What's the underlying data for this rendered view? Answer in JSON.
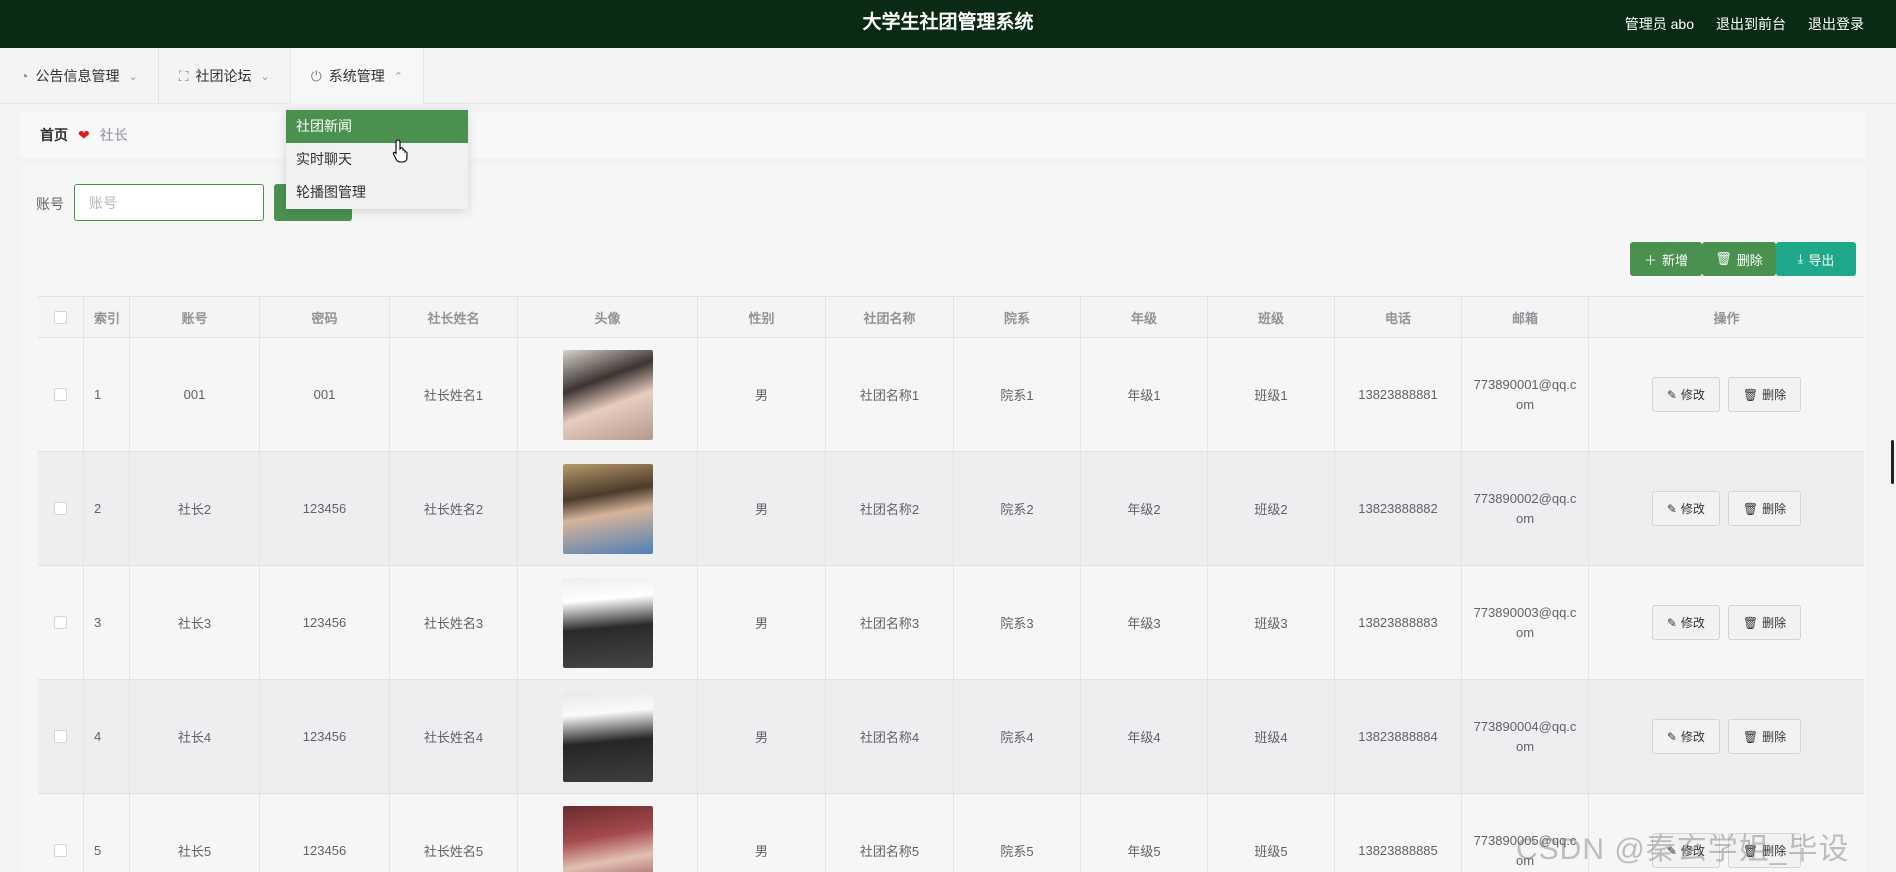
{
  "header": {
    "title": "大学生社团管理系统",
    "user": "管理员 abo",
    "to_front": "退出到前台",
    "logout": "退出登录"
  },
  "menu": [
    {
      "label": "公告信息管理",
      "icon": "dashboard-icon"
    },
    {
      "label": "社团论坛",
      "icon": "fullscreen-icon"
    },
    {
      "label": "系统管理",
      "icon": "power-icon"
    }
  ],
  "dropdown": {
    "items": [
      "社团新闻",
      "实时聊天",
      "轮播图管理"
    ],
    "hovered": "社团新闻"
  },
  "breadcrumb": {
    "home": "首页",
    "current": "社长"
  },
  "search": {
    "label": "账号",
    "placeholder": "账号",
    "value": ""
  },
  "actions": {
    "add": "新增",
    "delete": "删除",
    "export": "导出"
  },
  "table": {
    "columns": [
      "索引",
      "账号",
      "密码",
      "社长姓名",
      "头像",
      "性别",
      "社团名称",
      "院系",
      "年级",
      "班级",
      "电话",
      "邮箱",
      "操作"
    ],
    "rows": [
      {
        "index": "1",
        "account": "001",
        "password": "001",
        "name": "社长姓名1",
        "gender": "男",
        "club": "社团名称1",
        "dept": "院系1",
        "grade": "年级1",
        "class": "班级1",
        "phone": "13823888881",
        "email": "773890001@qq.com"
      },
      {
        "index": "2",
        "account": "社长2",
        "password": "123456",
        "name": "社长姓名2",
        "gender": "男",
        "club": "社团名称2",
        "dept": "院系2",
        "grade": "年级2",
        "class": "班级2",
        "phone": "13823888882",
        "email": "773890002@qq.com"
      },
      {
        "index": "3",
        "account": "社长3",
        "password": "123456",
        "name": "社长姓名3",
        "gender": "男",
        "club": "社团名称3",
        "dept": "院系3",
        "grade": "年级3",
        "class": "班级3",
        "phone": "13823888883",
        "email": "773890003@qq.com"
      },
      {
        "index": "4",
        "account": "社长4",
        "password": "123456",
        "name": "社长姓名4",
        "gender": "男",
        "club": "社团名称4",
        "dept": "院系4",
        "grade": "年级4",
        "class": "班级4",
        "phone": "13823888884",
        "email": "773890004@qq.com"
      },
      {
        "index": "5",
        "account": "社长5",
        "password": "123456",
        "name": "社长姓名5",
        "gender": "男",
        "club": "社团名称5",
        "dept": "院系5",
        "grade": "年级5",
        "class": "班级5",
        "phone": "13823888885",
        "email": "773890005@qq.com"
      }
    ],
    "row_actions": {
      "edit": "修改",
      "delete": "删除"
    }
  },
  "watermark": "CSDN @秦玄学姐_毕设",
  "colors": {
    "topbar": "#0b2a14",
    "primary": "#4a9150",
    "export": "#1fa88a",
    "heart": "#e01a1a"
  }
}
